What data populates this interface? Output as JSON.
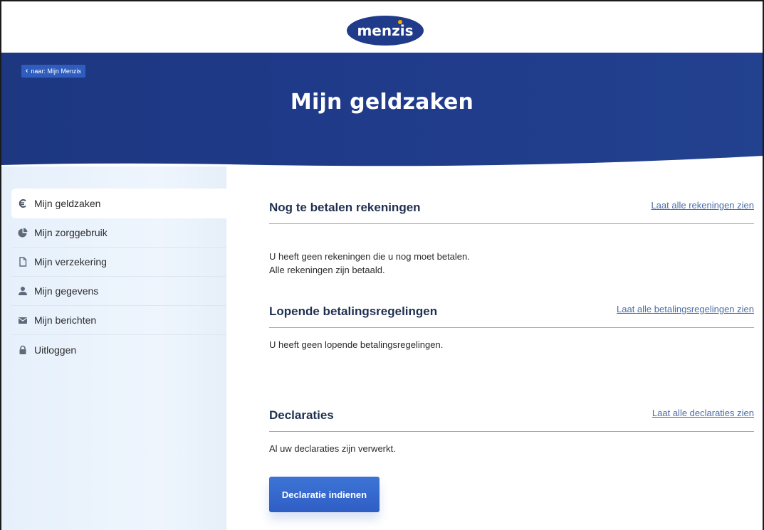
{
  "brand": {
    "logo_text": "menzis",
    "primary": "#1f3b8a",
    "accent": "#2f5ec4",
    "logo_dot": "#f5a800"
  },
  "hero": {
    "back_link": "naar: Mijn Menzis",
    "back_icon": "chevron-left-icon",
    "title": "Mijn geldzaken"
  },
  "sidebar": {
    "items": [
      {
        "label": "Mijn geldzaken",
        "icon": "euro-icon",
        "active": true
      },
      {
        "label": "Mijn zorggebruik",
        "icon": "pie-chart-icon",
        "active": false
      },
      {
        "label": "Mijn verzekering",
        "icon": "document-icon",
        "active": false
      },
      {
        "label": "Mijn gegevens",
        "icon": "user-icon",
        "active": false
      },
      {
        "label": "Mijn berichten",
        "icon": "mail-icon",
        "active": false
      },
      {
        "label": "Uitloggen",
        "icon": "lock-icon",
        "active": false
      }
    ]
  },
  "sections": {
    "unpaid": {
      "title": "Nog te betalen rekeningen",
      "link": "Laat alle rekeningen zien",
      "text_line1": "U heeft geen rekeningen die u nog moet betalen.",
      "text_line2": "Alle rekeningen zijn betaald."
    },
    "arrangements": {
      "title": "Lopende betalingsregelingen",
      "link": "Laat alle betalingsregelingen zien",
      "text": "U heeft geen lopende betalingsregelingen."
    },
    "claims": {
      "title": "Declaraties",
      "link": "Laat alle declaraties zien",
      "text": "Al uw declaraties zijn verwerkt.",
      "button": "Declaratie indienen"
    }
  }
}
